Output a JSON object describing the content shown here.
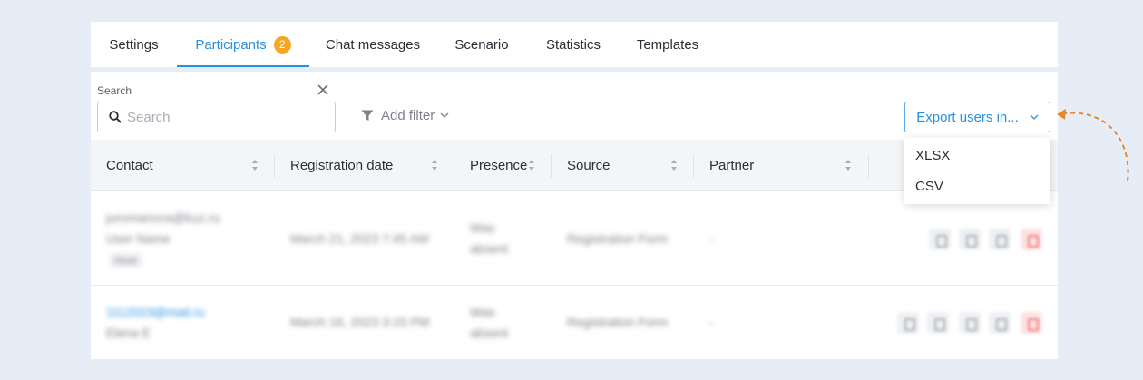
{
  "tabs": [
    {
      "label": "Settings"
    },
    {
      "label": "Participants",
      "badge": "2",
      "active": true
    },
    {
      "label": "Chat messages"
    },
    {
      "label": "Scenario"
    },
    {
      "label": "Statistics"
    },
    {
      "label": "Templates"
    }
  ],
  "search": {
    "label": "Search",
    "placeholder": "Search"
  },
  "filter": {
    "label": "Add filter"
  },
  "export": {
    "label": "Export users in...",
    "options": [
      "XLSX",
      "CSV"
    ]
  },
  "columns": [
    "Contact",
    "Registration date",
    "Presence",
    "Source",
    "Partner"
  ],
  "rows": [
    {
      "email": "juromanova@kuz.ru",
      "name": "User Name",
      "tag": "Host",
      "date": "March 21, 2023 7:45 AM",
      "presence_1": "Was",
      "presence_2": "absent",
      "source": "Registration Form",
      "partner": "-"
    },
    {
      "email": "1112023@mail.ru",
      "name": "Elena E",
      "date": "March 16, 2023 3:15 PM",
      "presence_1": "Was",
      "presence_2": "absent",
      "source": "Registration Form",
      "partner": "-"
    }
  ],
  "colors": {
    "accent": "#2a8fe0",
    "badge": "#f5a623",
    "annotation": "#e8862e"
  }
}
